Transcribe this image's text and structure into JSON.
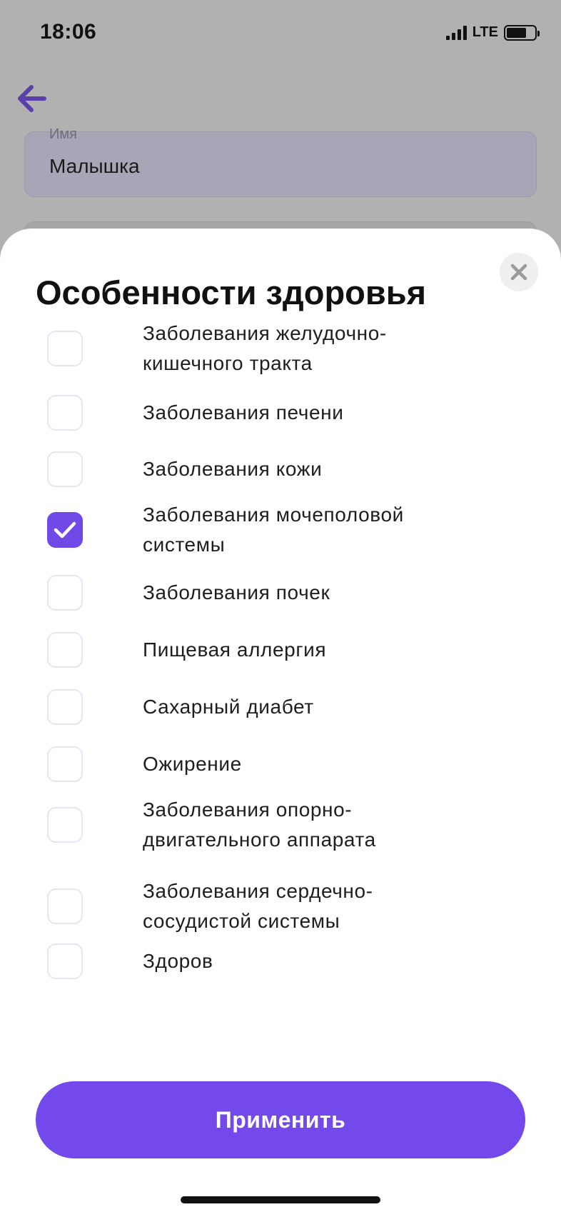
{
  "status_bar": {
    "time": "18:06",
    "network": "LTE"
  },
  "background": {
    "name_field": {
      "label": "Имя",
      "value": "Малышка"
    }
  },
  "sheet": {
    "title": "Особенности здоровья",
    "options": [
      {
        "label": "Заболевания желудочно-кишечного тракта",
        "checked": false
      },
      {
        "label": "Заболевания печени",
        "checked": false
      },
      {
        "label": "Заболевания кожи",
        "checked": false
      },
      {
        "label": "Заболевания мочеполовой системы",
        "checked": true
      },
      {
        "label": "Заболевания почек",
        "checked": false
      },
      {
        "label": "Пищевая аллергия",
        "checked": false
      },
      {
        "label": "Сахарный диабет",
        "checked": false
      },
      {
        "label": "Ожирение",
        "checked": false
      },
      {
        "label": "Заболевания опорно-двигательного аппарата",
        "checked": false
      },
      {
        "label": "Заболевания сердечно-сосудистой системы",
        "checked": false
      },
      {
        "label": "Здоров",
        "checked": false
      }
    ],
    "apply_label": "Применить"
  },
  "colors": {
    "accent": "#7349eb",
    "checkbox_border": "#e7e4f4",
    "overlay": "#b1b1b1"
  },
  "icons": {
    "back": "arrow-left-icon",
    "close": "close-icon",
    "check": "checkmark-icon"
  }
}
